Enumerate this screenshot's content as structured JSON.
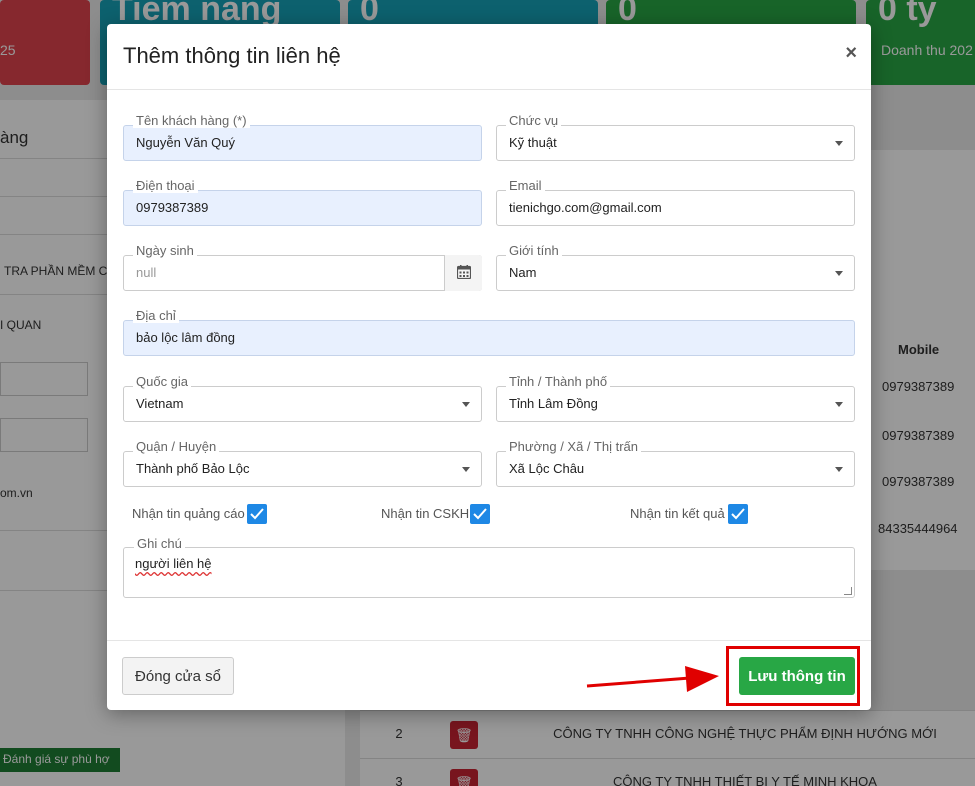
{
  "background": {
    "cards": [
      {
        "big": "",
        "small": "25"
      },
      {
        "big": "Tiềm năng",
        "small": ""
      },
      {
        "big": "0",
        "small": ""
      },
      {
        "big": "0",
        "small": ""
      },
      {
        "big": "0 tỷ",
        "small": "Doanh thu 202"
      }
    ],
    "left_panel": {
      "heading": "àng",
      "row1": "TRA PHẦN MỀM C",
      "row2": "I QUAN",
      "row3": "om.vn",
      "green_button": "Đánh giá sự phù hợ"
    },
    "right_panel": {
      "header": "Mobile",
      "values": [
        "0979387389",
        "0979387389",
        "0979387389",
        "84335444964"
      ]
    },
    "bottom_table": [
      {
        "num": "2",
        "name": "CÔNG TY TNHH CÔNG NGHỆ THỰC PHẨM ĐỊNH HƯỚNG MỚI"
      },
      {
        "num": "3",
        "name": "CÔNG TY TNHH THIẾT BỊ Y TẾ MINH KHOA"
      }
    ]
  },
  "modal": {
    "title": "Thêm thông tin liên hệ",
    "close_symbol": "×",
    "fields": {
      "customer_name": {
        "label": "Tên khách hàng (*)",
        "value": "Nguyễn Văn Quý"
      },
      "position": {
        "label": "Chức vụ",
        "value": "Kỹ thuật"
      },
      "phone": {
        "label": "Điện thoại",
        "value": "0979387389"
      },
      "email": {
        "label": "Email",
        "value": "tienichgo.com@gmail.com"
      },
      "birthday": {
        "label": "Ngày sinh",
        "placeholder": "null"
      },
      "gender": {
        "label": "Giới tính",
        "value": "Nam"
      },
      "address": {
        "label": "Địa chỉ",
        "value": "bảo lộc lâm đồng"
      },
      "country": {
        "label": "Quốc gia",
        "value": "Vietnam"
      },
      "province": {
        "label": "Tỉnh / Thành phố",
        "value": "Tỉnh Lâm Đồng"
      },
      "district": {
        "label": "Quận / Huyện",
        "value": "Thành phố Bảo Lộc"
      },
      "ward": {
        "label": "Phường / Xã / Thị trấn",
        "value": "Xã Lộc Châu"
      }
    },
    "checkboxes": [
      {
        "label": "Nhận tin quảng cáo",
        "checked": true
      },
      {
        "label": "Nhận tin CSKH",
        "checked": true
      },
      {
        "label": "Nhận tin kết quả",
        "checked": true
      }
    ],
    "notes": {
      "label": "Ghi chú",
      "value": "người liên hệ"
    },
    "footer": {
      "close_button": "Đóng cửa sổ",
      "save_button": "Lưu thông tin"
    }
  },
  "colors": {
    "save_green": "#28a745",
    "checkbox_blue": "#1e88e5",
    "highlight_red": "#e00000",
    "autofill_bg": "#e8f0fe"
  }
}
